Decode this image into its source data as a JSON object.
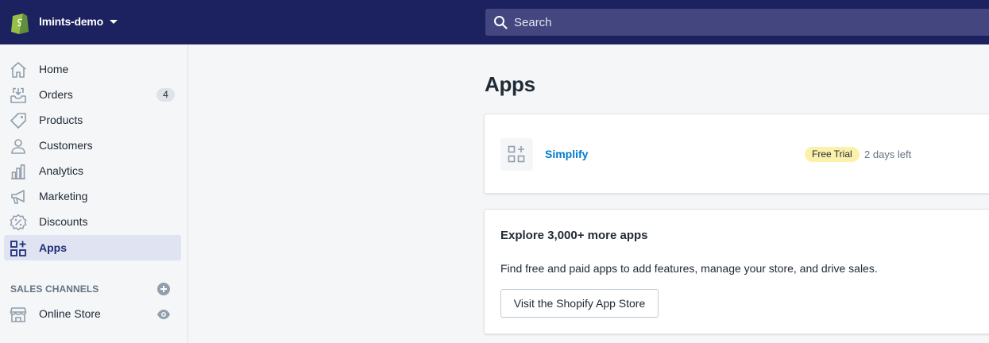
{
  "topbar": {
    "store_name": "lmints-demo",
    "search_placeholder": "Search",
    "accent": "#1c2260"
  },
  "sidebar": {
    "items": [
      {
        "label": "Home",
        "icon": "home-icon"
      },
      {
        "label": "Orders",
        "icon": "orders-icon",
        "badge": "4"
      },
      {
        "label": "Products",
        "icon": "tag-icon"
      },
      {
        "label": "Customers",
        "icon": "person-icon"
      },
      {
        "label": "Analytics",
        "icon": "bar-chart-icon"
      },
      {
        "label": "Marketing",
        "icon": "megaphone-icon"
      },
      {
        "label": "Discounts",
        "icon": "discount-icon"
      },
      {
        "label": "Apps",
        "icon": "apps-icon",
        "active": true
      }
    ],
    "sales_channels": {
      "title": "SALES CHANNELS",
      "items": [
        {
          "label": "Online Store",
          "icon": "store-icon"
        }
      ]
    }
  },
  "main": {
    "title": "Apps",
    "installed_apps": [
      {
        "name": "Simplify",
        "badge": "Free Trial",
        "status": "2 days left",
        "badge_color": "#fcf1aa"
      }
    ],
    "explore": {
      "title": "Explore 3,000+ more apps",
      "description": "Find free and paid apps to add features, manage your store, and drive sales.",
      "button_label": "Visit the Shopify App Store"
    }
  }
}
